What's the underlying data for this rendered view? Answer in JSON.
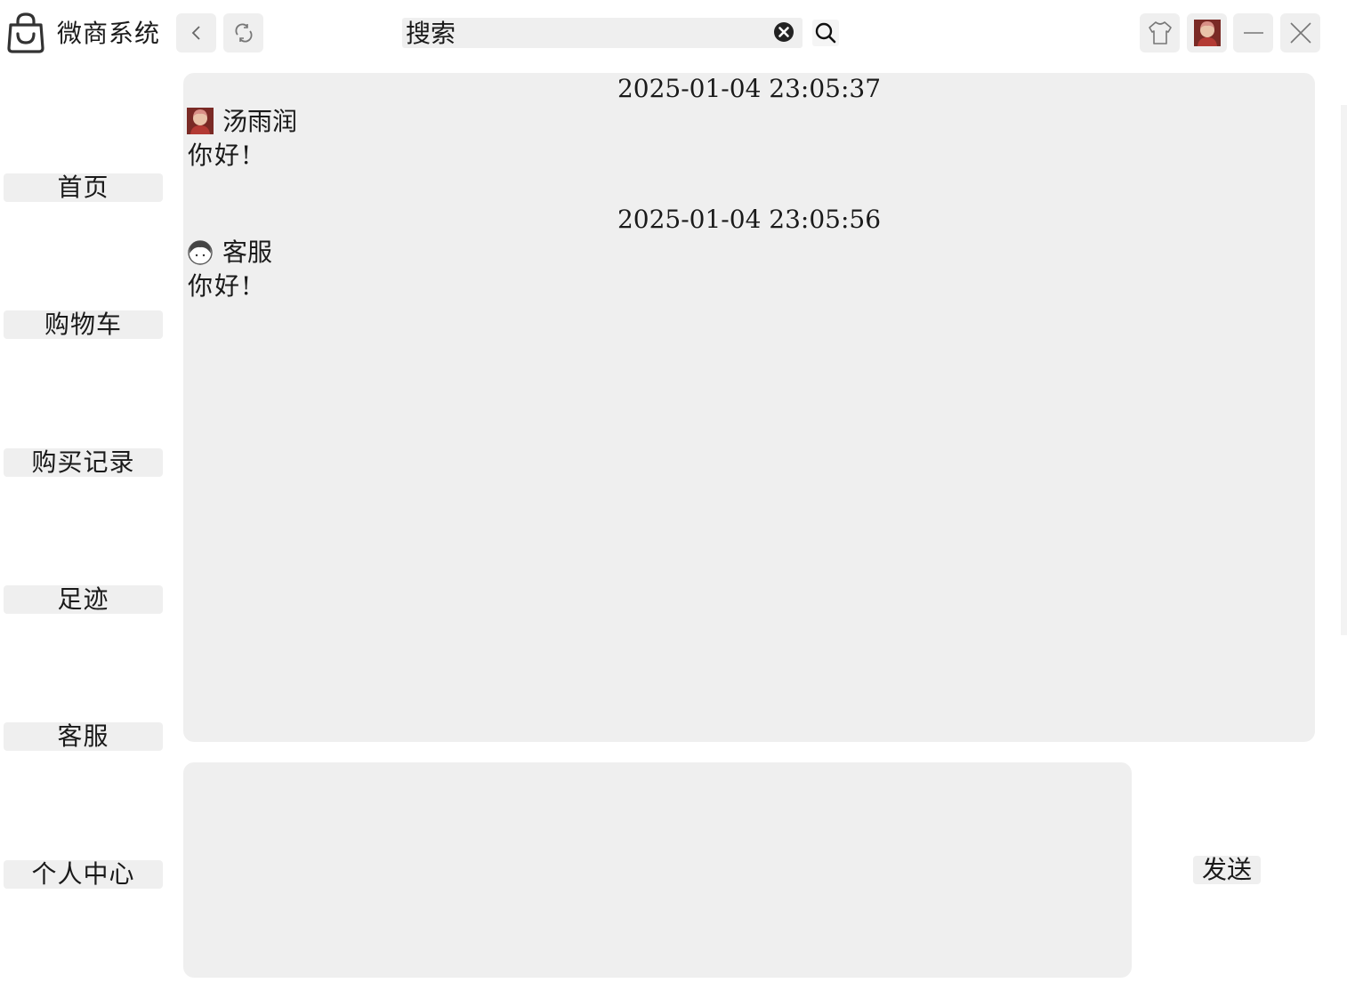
{
  "header": {
    "app_title": "微商系统",
    "search_placeholder": "搜索",
    "icons": [
      "bag-logo-icon",
      "back-icon",
      "refresh-icon",
      "clear-icon",
      "search-icon",
      "shirt-skin-icon",
      "user-avatar",
      "minimize-icon",
      "close-icon"
    ]
  },
  "sidebar": {
    "items": [
      {
        "label": "首页"
      },
      {
        "label": "购物车"
      },
      {
        "label": "购买记录"
      },
      {
        "label": "足迹"
      },
      {
        "label": "客服"
      },
      {
        "label": "个人中心"
      }
    ]
  },
  "chat": {
    "messages": [
      {
        "time": "2025-01-04 23:05:37",
        "sender": "汤雨润",
        "avatar": "user-avatar",
        "text": "你好!"
      },
      {
        "time": "2025-01-04 23:05:56",
        "sender": "客服",
        "avatar": "service-avatar",
        "text": "你好!"
      }
    ],
    "compose_value": "",
    "send_label": "发送"
  },
  "colors": {
    "panel": "#efefef",
    "background": "#ffffff",
    "text": "#1a1a1a",
    "avatar_red": "#b33a34"
  }
}
